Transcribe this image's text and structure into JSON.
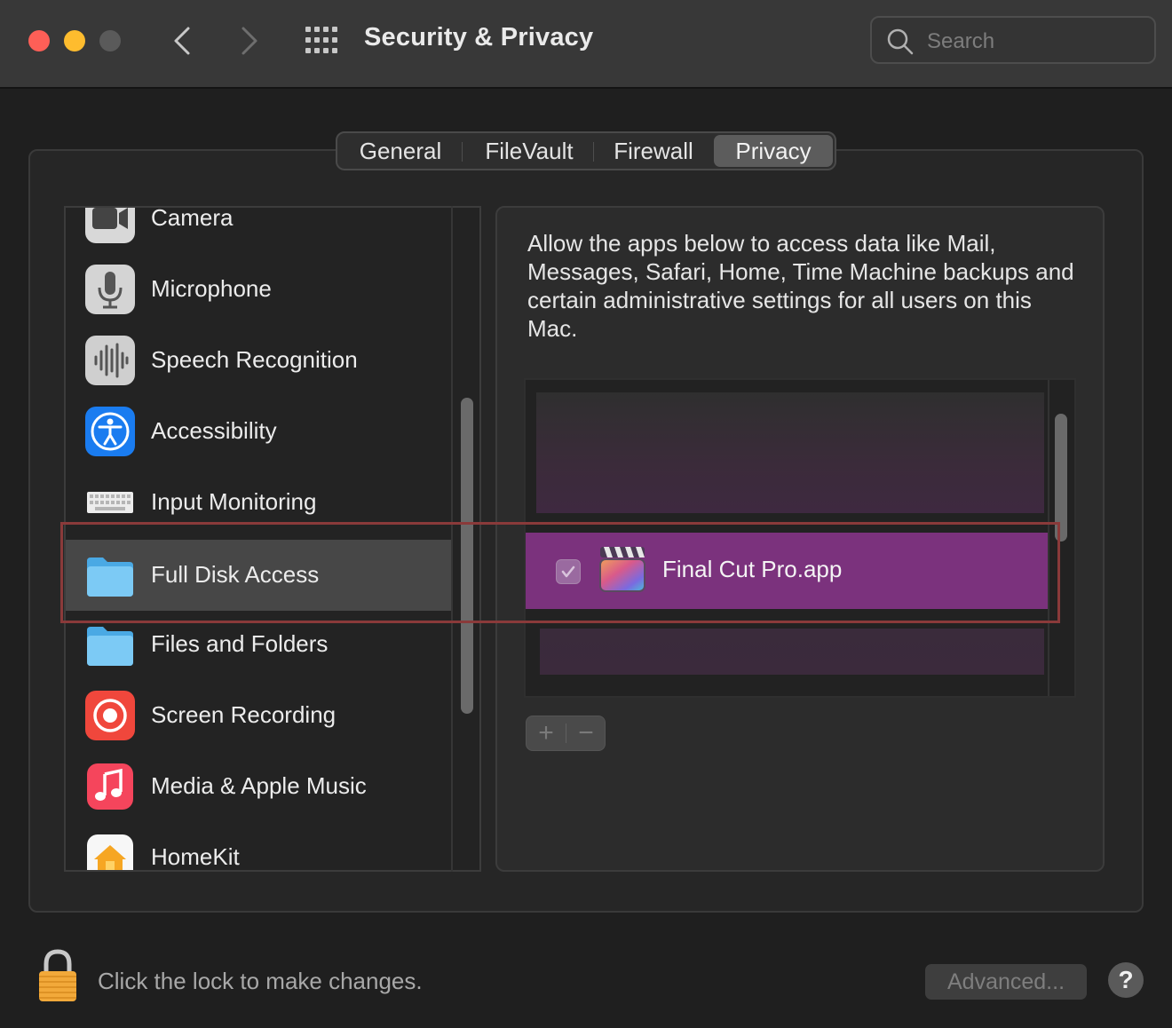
{
  "window": {
    "title": "Security & Privacy"
  },
  "search": {
    "placeholder": "Search"
  },
  "tabs": [
    {
      "label": "General",
      "active": false
    },
    {
      "label": "FileVault",
      "active": false
    },
    {
      "label": "Firewall",
      "active": false
    },
    {
      "label": "Privacy",
      "active": true
    }
  ],
  "sidebar": {
    "items": [
      {
        "label": "Camera",
        "icon": "camera-icon",
        "selected": false
      },
      {
        "label": "Microphone",
        "icon": "microphone-icon",
        "selected": false
      },
      {
        "label": "Speech Recognition",
        "icon": "speech-waveform-icon",
        "selected": false
      },
      {
        "label": "Accessibility",
        "icon": "accessibility-icon",
        "selected": false
      },
      {
        "label": "Input Monitoring",
        "icon": "keyboard-icon",
        "selected": false
      },
      {
        "label": "Full Disk Access",
        "icon": "folder-icon",
        "selected": true
      },
      {
        "label": "Files and Folders",
        "icon": "folder-icon",
        "selected": false
      },
      {
        "label": "Screen Recording",
        "icon": "screen-recording-icon",
        "selected": false
      },
      {
        "label": "Media & Apple Music",
        "icon": "music-note-icon",
        "selected": false
      },
      {
        "label": "HomeKit",
        "icon": "home-icon",
        "selected": false
      }
    ]
  },
  "panel": {
    "description": "Allow the apps below to access data like Mail, Messages, Safari, Home, Time Machine backups and certain administrative settings for all users on this Mac.",
    "apps": [
      {
        "name": "Final Cut Pro.app",
        "checked": true,
        "icon": "final-cut-pro-icon",
        "selected": true
      }
    ],
    "add_label": "+",
    "remove_label": "−"
  },
  "footer": {
    "lock_text": "Click the lock to make changes.",
    "advanced_label": "Advanced...",
    "help_label": "?"
  },
  "colors": {
    "accent_selected_row": "#7b327d",
    "highlight_box": "#8a3a3a",
    "traffic_red": "#fe5f57",
    "traffic_yellow": "#febc2e"
  }
}
